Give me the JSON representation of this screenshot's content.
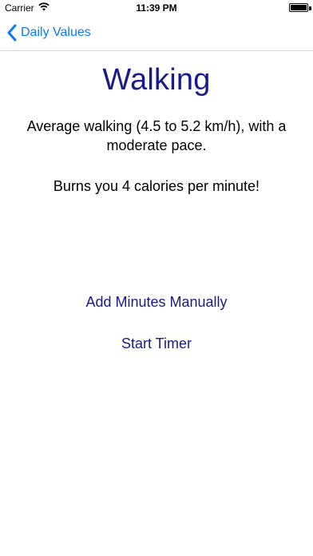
{
  "status_bar": {
    "carrier": "Carrier",
    "time": "11:39 PM",
    "battery_level_percent": 100
  },
  "nav": {
    "back_label": "Daily Values",
    "back_color": "#0a7aff"
  },
  "activity": {
    "title": "Walking",
    "description": "Average walking (4.5 to 5.2 km/h), with a moderate pace.",
    "burn_text": "Burns you 4 calories per minute!"
  },
  "actions": {
    "add_minutes_label": "Add Minutes Manually",
    "start_timer_label": "Start Timer"
  },
  "colors": {
    "accent": "#1a1a8c",
    "link": "#0a7aff"
  }
}
